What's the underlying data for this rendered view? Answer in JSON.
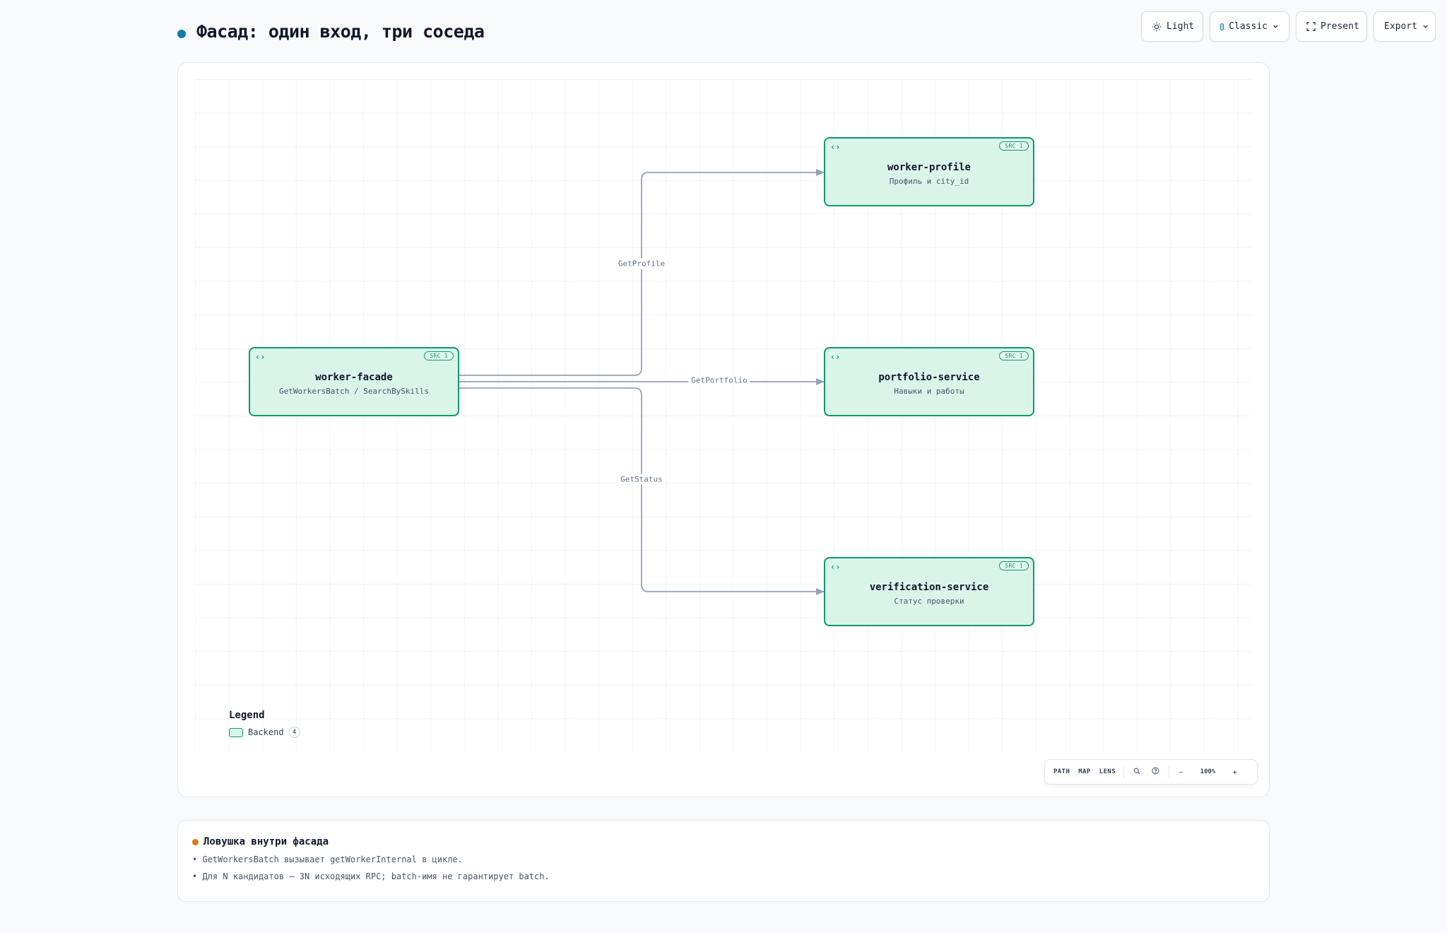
{
  "header": {
    "title": "Фасад: один вход, три соседа",
    "title_dot_color": "#0e7fa8",
    "buttons": {
      "theme_label": "Light",
      "style_label": "Classic",
      "present_label": "Present",
      "export_label": "Export"
    }
  },
  "diagram": {
    "nodes": {
      "worker_facade": {
        "title": "worker-facade",
        "subtitle": "GetWorkersBatch / SearchBySkills",
        "badge": "SRC 1",
        "icon": "code-icon"
      },
      "worker_profile": {
        "title": "worker-profile",
        "subtitle": "Профиль и city_id",
        "badge": "SRC 1",
        "icon": "code-icon"
      },
      "portfolio_service": {
        "title": "portfolio-service",
        "subtitle": "Навыки и работы",
        "badge": "SRC 1",
        "icon": "code-icon"
      },
      "verification_service": {
        "title": "verification-service",
        "subtitle": "Статус проверки",
        "badge": "SRC 1",
        "icon": "code-icon"
      }
    },
    "edges": [
      {
        "from": "worker-facade",
        "to": "worker-profile",
        "label": "GetProfile"
      },
      {
        "from": "worker-facade",
        "to": "portfolio-service",
        "label": "GetPortfolio"
      },
      {
        "from": "worker-facade",
        "to": "verification-service",
        "label": "GetStatus"
      }
    ],
    "colors": {
      "node_fill": "#d9f5e9",
      "node_border": "#0f9a6b",
      "edge": "#94a3b8"
    }
  },
  "legend": {
    "title": "Legend",
    "items": [
      {
        "label": "Backend",
        "count": "4"
      }
    ]
  },
  "canvas_toolbar": {
    "path_label": "PATH",
    "map_label": "MAP",
    "lens_label": "LENS",
    "zoom_out": "−",
    "zoom_level": "100%",
    "zoom_in": "+"
  },
  "note": {
    "title": "Ловушка внутри фасада",
    "dot_color": "#e07b16",
    "lines": [
      "• GetWorkersBatch вызывает getWorkerInternal в цикле.",
      "• Для N кандидатов — 3N исходящих RPC; batch-имя не гарантирует batch."
    ]
  }
}
